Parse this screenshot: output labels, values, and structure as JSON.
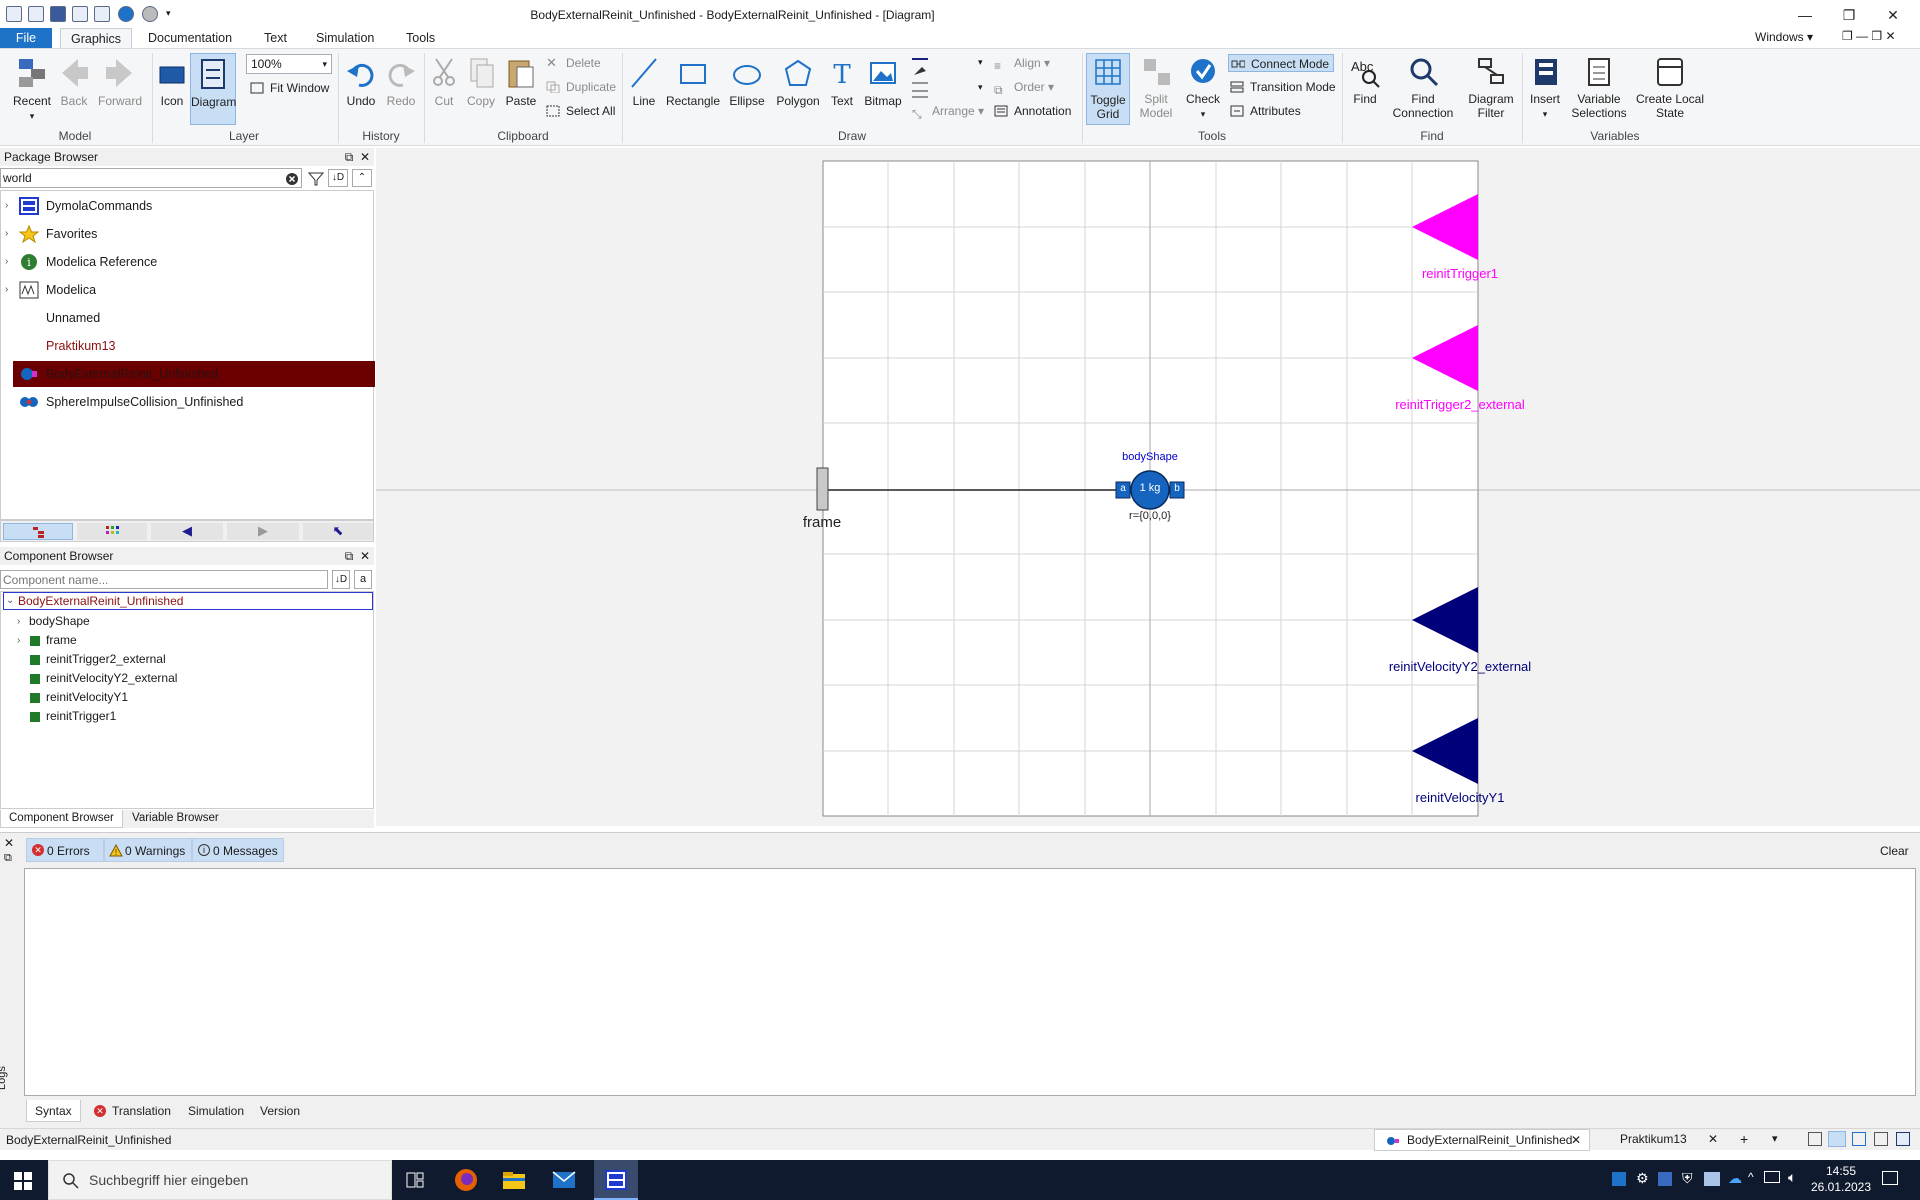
{
  "window": {
    "title": "BodyExternalReinit_Unfinished - BodyExternalReinit_Unfinished - [Diagram]",
    "windows_menu": "Windows",
    "minimize": "—",
    "restore": "❐",
    "close": "✕"
  },
  "menu": {
    "tabs": [
      "File",
      "Graphics",
      "Documentation",
      "Text",
      "Simulation",
      "Tools"
    ]
  },
  "ribbon": {
    "model": {
      "recent": "Recent",
      "back": "Back",
      "forward": "Forward",
      "label": "Model"
    },
    "layer": {
      "icon": "Icon",
      "diagram": "Diagram",
      "zoom": "100%",
      "fit_window": "Fit Window",
      "label": "Layer"
    },
    "history": {
      "undo": "Undo",
      "redo": "Redo",
      "label": "History"
    },
    "clipboard": {
      "cut": "Cut",
      "copy": "Copy",
      "paste": "Paste",
      "delete": "Delete",
      "duplicate": "Duplicate",
      "select_all": "Select All",
      "label": "Clipboard"
    },
    "draw": {
      "line": "Line",
      "rectangle": "Rectangle",
      "ellipse": "Ellipse",
      "polygon": "Polygon",
      "text": "Text",
      "bitmap": "Bitmap",
      "align": "Align",
      "order": "Order",
      "arrange": "Arrange",
      "annotation": "Annotation",
      "label": "Draw"
    },
    "tools": {
      "toggle_grid": "Toggle\nGrid",
      "toggle_grid_1": "Toggle",
      "toggle_grid_2": "Grid",
      "split_model_1": "Split",
      "split_model_2": "Model",
      "check": "Check",
      "connect_mode": "Connect Mode",
      "transition_mode": "Transition Mode",
      "attributes": "Attributes",
      "label": "Tools"
    },
    "find": {
      "find": "Find",
      "find_connection_1": "Find",
      "find_connection_2": "Connection",
      "diagram_filter_1": "Diagram",
      "diagram_filter_2": "Filter",
      "label": "Find"
    },
    "variables": {
      "insert": "Insert",
      "variable_selections_1": "Variable",
      "variable_selections_2": "Selections",
      "create_local_state_1": "Create Local",
      "create_local_state_2": "State",
      "label": "Variables"
    }
  },
  "package_browser": {
    "title": "Package Browser",
    "search_value": "world",
    "items": [
      {
        "label": "DymolaCommands",
        "icon": "dymola-commands-icon"
      },
      {
        "label": "Favorites",
        "icon": "star-icon"
      },
      {
        "label": "Modelica Reference",
        "icon": "info-icon"
      },
      {
        "label": "Modelica",
        "icon": "modelica-icon"
      },
      {
        "label": "Unnamed",
        "icon": ""
      },
      {
        "label": "Praktikum13",
        "icon": ""
      },
      {
        "label": "BodyExternalReinit_Unfinished",
        "icon": "body-model-icon"
      },
      {
        "label": "SphereImpulseCollision_Unfinished",
        "icon": "sphere-model-icon"
      }
    ]
  },
  "component_browser": {
    "title": "Component Browser",
    "placeholder": "Component name...",
    "root": "BodyExternalReinit_Unfinished",
    "items": [
      "bodyShape",
      "frame",
      "reinitTrigger2_external",
      "reinitVelocityY2_external",
      "reinitVelocityY1",
      "reinitTrigger1"
    ],
    "tabs": [
      "Component Browser",
      "Variable Browser"
    ]
  },
  "diagram": {
    "body_label": "bodyShape",
    "body_mass": "1 kg",
    "body_a": "a",
    "body_b": "b",
    "body_param": "r={0,0,0}",
    "frame_label": "frame",
    "trigger1": "reinitTrigger1",
    "trigger2": "reinitTrigger2_external",
    "velocity_y2": "reinitVelocityY2_external",
    "velocity_y1": "reinitVelocityY1",
    "colors": {
      "trigger": "#ff00ff",
      "velocity": "#00007a",
      "body": "#1565c0",
      "label_blue": "#0000cc"
    }
  },
  "messages": {
    "errors": "0 Errors",
    "warnings": "0 Warnings",
    "messages": "0 Messages",
    "clear": "Clear",
    "logs": "Logs",
    "tabs": [
      "Syntax",
      "Translation",
      "Simulation",
      "Version"
    ]
  },
  "statusbar": {
    "left": "BodyExternalReinit_Unfinished",
    "doc_tab_1": "BodyExternalReinit_Unfinished",
    "doc_tab_2": "Praktikum13"
  },
  "taskbar": {
    "search_placeholder": "Suchbegriff hier eingeben",
    "time": "14:55",
    "date": "26.01.2023"
  }
}
